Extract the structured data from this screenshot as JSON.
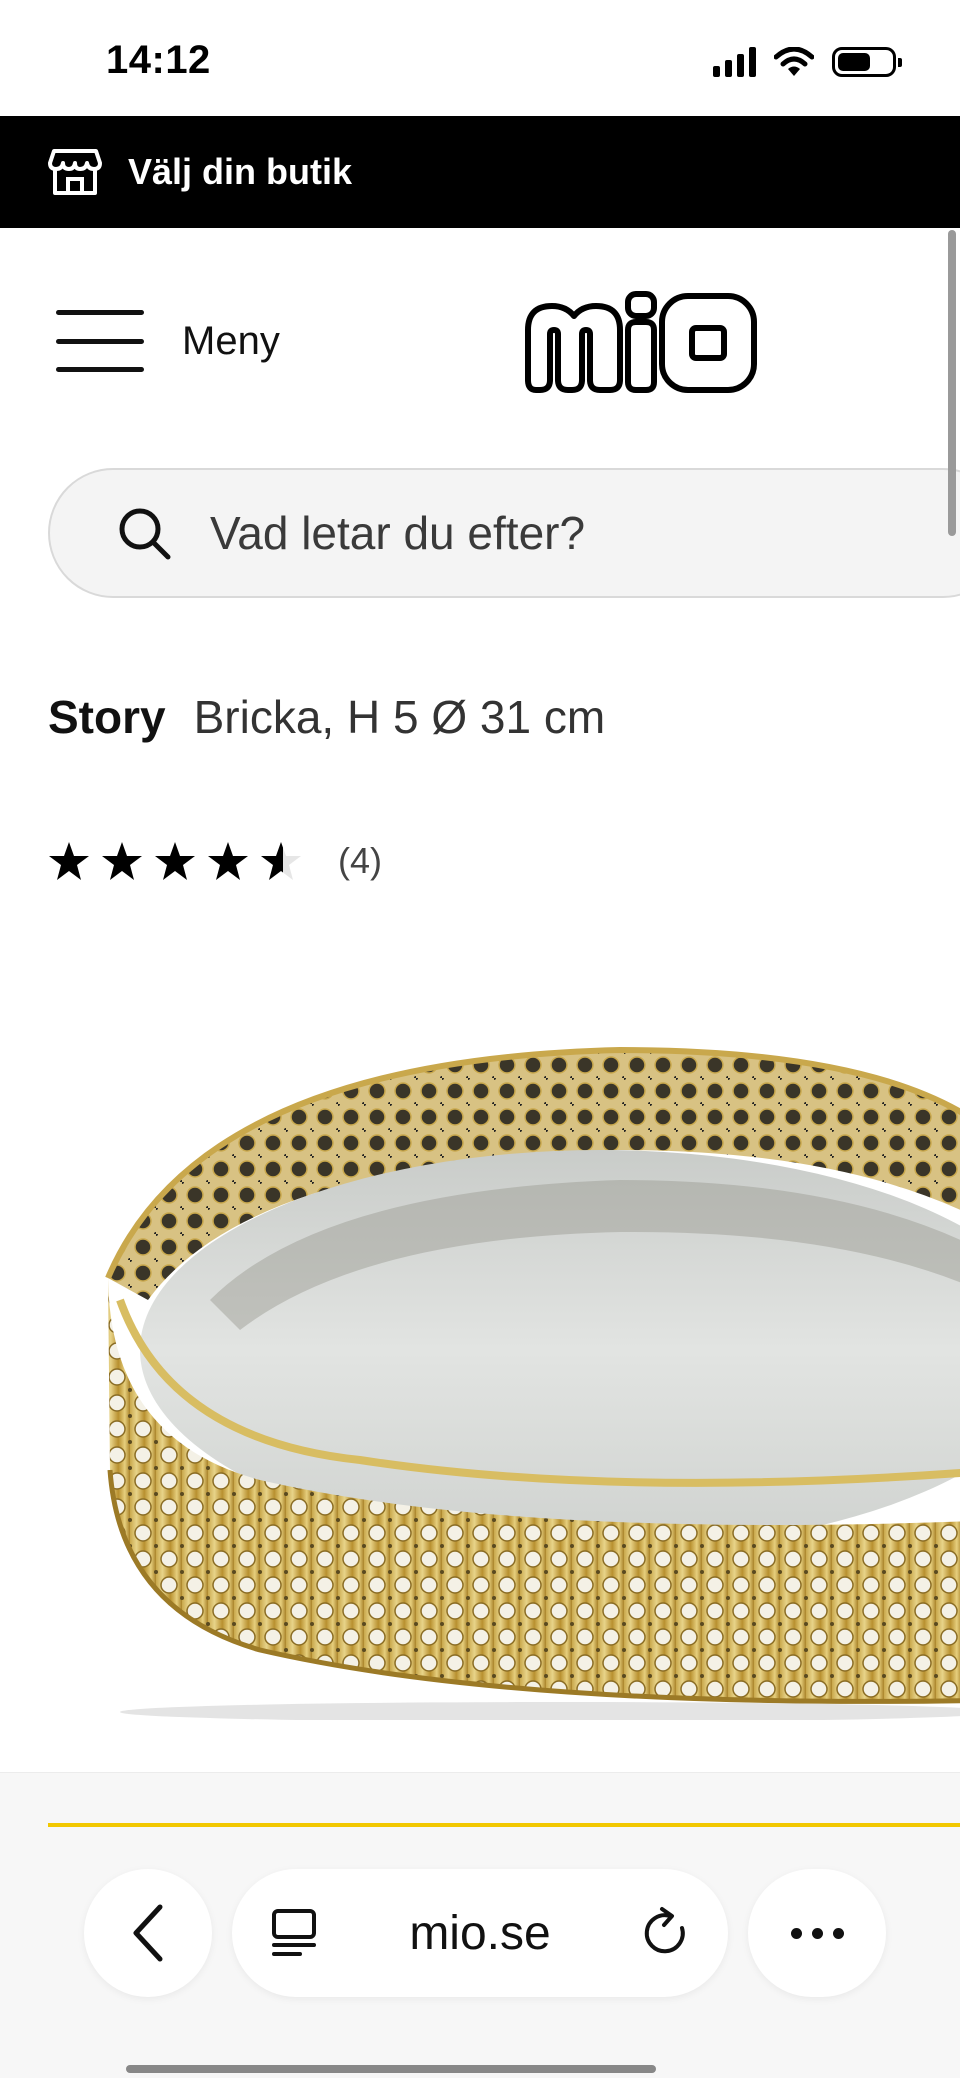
{
  "status_bar": {
    "time": "14:12"
  },
  "store_banner": {
    "label": "Välj din butik"
  },
  "header": {
    "menu_label": "Meny",
    "logo_text": "MiO"
  },
  "search": {
    "placeholder": "Vad letar du efter?"
  },
  "product": {
    "brand": "Story",
    "name": "Bricka, H 5 Ø 31 cm",
    "rating": 4.5,
    "review_count": "(4)"
  },
  "browser": {
    "address": "mio.se"
  },
  "colors": {
    "banner_bg": "#000000",
    "accent": "#f2c800",
    "search_bg": "#f4f4f4"
  },
  "icons": {
    "store": "store-icon",
    "menu": "hamburger-icon",
    "search": "search-icon",
    "back": "chevron-left-icon",
    "reader": "reader-mode-icon",
    "reload": "reload-icon",
    "more": "more-icon"
  }
}
